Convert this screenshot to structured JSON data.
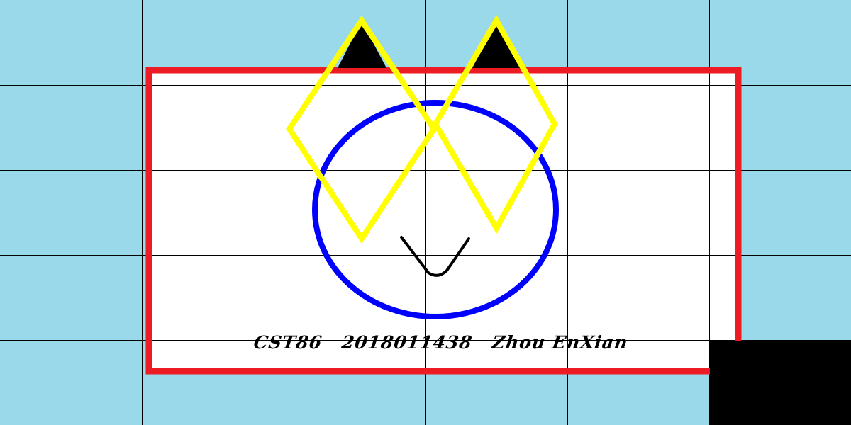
{
  "caption": {
    "course": "CST86",
    "student_id": "2018011438",
    "name": "Zhou EnXian"
  },
  "colors": {
    "background": "#99d9ea",
    "grid": "#000000",
    "frame_fill": "#ffffff",
    "frame_border": "#ed1c24",
    "circle": "#0000ff",
    "diamond": "#ffff00",
    "diamond_tip": "#000000",
    "smile": "#000000",
    "corner_block": "#000000"
  }
}
